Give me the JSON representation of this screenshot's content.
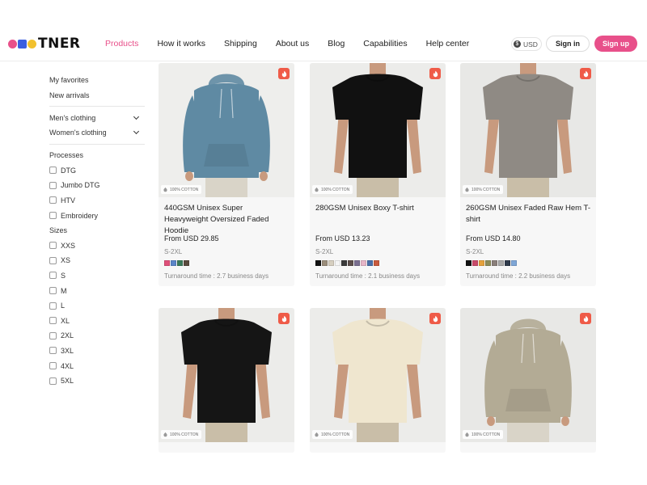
{
  "brand": {
    "logo_text": "TNER",
    "logo_colors": [
      "#e8508a",
      "#3b5ee0",
      "#f2c12e"
    ]
  },
  "nav": {
    "items": [
      "Products",
      "How it works",
      "Shipping",
      "About us",
      "Blog",
      "Capabilities",
      "Help center"
    ],
    "active": "Products"
  },
  "header": {
    "currency": "USD",
    "currency_icon": "dollar-icon",
    "sign_in": "Sign in",
    "sign_up": "Sign up",
    "accent": "#e8508a"
  },
  "sidebar": {
    "links": [
      "My favorites",
      "New arrivals"
    ],
    "categories": [
      "Men's clothing",
      "Women's clothing"
    ],
    "processes_heading": "Processes",
    "processes": [
      "DTG",
      "Jumbo DTG",
      "HTV",
      "Embroidery"
    ],
    "sizes_heading": "Sizes",
    "sizes": [
      "XXS",
      "XS",
      "S",
      "M",
      "L",
      "XL",
      "2XL",
      "3XL",
      "4XL",
      "5XL"
    ]
  },
  "badges": {
    "cotton": "100% COTTON",
    "hot_icon": "fire-icon"
  },
  "products": [
    {
      "title": "440GSM Unisex Super Heavyweight Oversized Faded Hoodie",
      "price": "From USD 29.85",
      "sizes": "S-2XL",
      "turnaround": "Turnaround time : 2.7 business days",
      "swatches": [
        "#e0507a",
        "#5b86c9",
        "#3b7a5a",
        "#5a4a3e"
      ],
      "garment": "hoodie",
      "garment_color": "#5f8aa3",
      "bg": "#eeeeec"
    },
    {
      "title": "280GSM Unisex Boxy T-shirt",
      "price": "From USD 13.23",
      "sizes": "S-2XL",
      "turnaround": "Turnaround time : 2.1 business days",
      "swatches": [
        "#111111",
        "#9a8d7a",
        "#d6cfc0",
        "#f5f5f5",
        "#3a3a3a",
        "#5c4e4a",
        "#7a6f90",
        "#e6b6c8",
        "#4b6fa8",
        "#c85a3e"
      ],
      "garment": "tee",
      "garment_color": "#111111",
      "bg": "#ececea"
    },
    {
      "title": "260GSM Unisex Faded Raw Hem T-shirt",
      "price": "From USD 14.80",
      "sizes": "S-2XL",
      "turnaround": "Turnaround time : 2.2 business days",
      "swatches": [
        "#111111",
        "#c94a6a",
        "#e6a23c",
        "#8c8c5a",
        "#8a7f7a",
        "#a8a8a8",
        "#2f3a4a",
        "#7ea6d6"
      ],
      "garment": "tee",
      "garment_color": "#8f8a84",
      "bg": "#e8e8e6"
    },
    {
      "title": "",
      "price": "",
      "sizes": "",
      "turnaround": "",
      "swatches": [],
      "garment": "tee",
      "garment_color": "#151515",
      "bg": "#ececea"
    },
    {
      "title": "",
      "price": "",
      "sizes": "",
      "turnaround": "",
      "swatches": [],
      "garment": "tee",
      "garment_color": "#efe6cf",
      "bg": "#ececea"
    },
    {
      "title": "",
      "price": "",
      "sizes": "",
      "turnaround": "",
      "swatches": [],
      "garment": "hoodie",
      "garment_color": "#b3ab95",
      "bg": "#e8e8e6"
    }
  ]
}
